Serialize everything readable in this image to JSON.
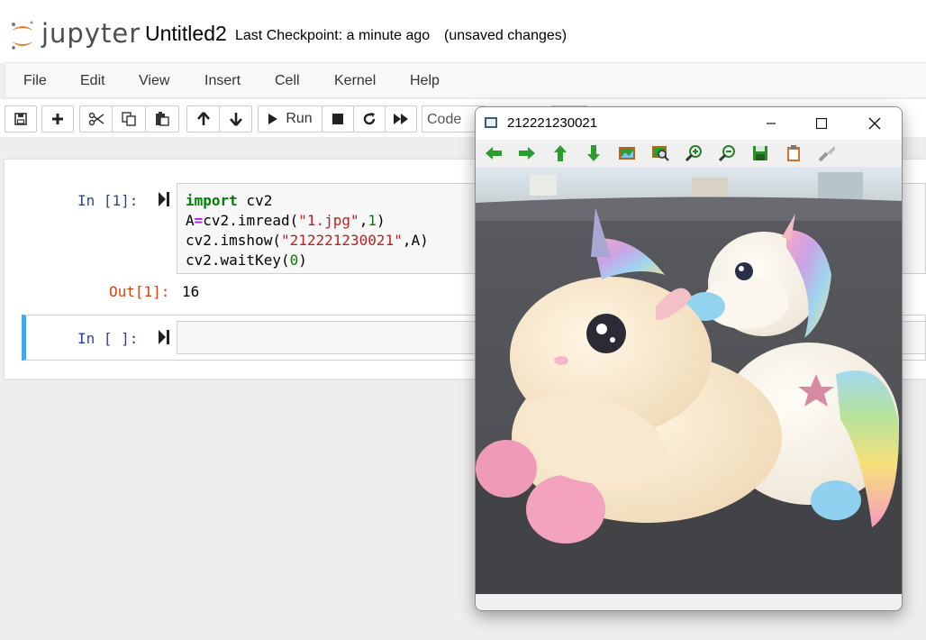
{
  "header": {
    "logo_text": "jupyter",
    "notebook_title": "Untitled2",
    "checkpoint": "Last Checkpoint: a minute ago",
    "unsaved": "(unsaved changes)"
  },
  "menu": {
    "items": [
      "File",
      "Edit",
      "View",
      "Insert",
      "Cell",
      "Kernel",
      "Help"
    ]
  },
  "toolbar": {
    "run_label": "Run",
    "cell_type": "Code",
    "icons": [
      "save-icon",
      "plus-icon",
      "scissors-icon",
      "copy-icon",
      "paste-icon",
      "arrow-up-icon",
      "arrow-down-icon",
      "play-icon",
      "stop-icon",
      "restart-icon",
      "fast-forward-icon"
    ]
  },
  "cells": {
    "cell1": {
      "in_prompt": "In [1]:",
      "code": {
        "l1_kw": "import",
        "l1_rest": " cv2",
        "l2_a": "A",
        "l2_eq": "=",
        "l2_call": "cv2.imread(",
        "l2_str": "\"1.jpg\"",
        "l2_comma": ",",
        "l2_num": "1",
        "l2_close": ")",
        "l3_call": "cv2.imshow(",
        "l3_str": "\"212221230021\"",
        "l3_rest": ",A)",
        "l4_call": "cv2.waitKey(",
        "l4_num": "0",
        "l4_close": ")"
      },
      "out_prompt": "Out[1]:",
      "output": "16"
    },
    "cell2": {
      "in_prompt": "In [ ]:"
    }
  },
  "image_window": {
    "title": "212221230021",
    "toolbar_icons": [
      "pan-left-icon",
      "pan-right-icon",
      "pan-up-icon",
      "pan-down-icon",
      "zoom-fit-icon",
      "zoom-region-icon",
      "zoom-in-icon",
      "zoom-out-icon",
      "save-image-icon",
      "copy-clipboard-icon",
      "properties-icon"
    ],
    "colors": {
      "arrow_green": "#2e9b2e",
      "accent_blue": "#42a5f5",
      "in_prompt": "#303f9f",
      "out_prompt": "#d84315"
    }
  }
}
